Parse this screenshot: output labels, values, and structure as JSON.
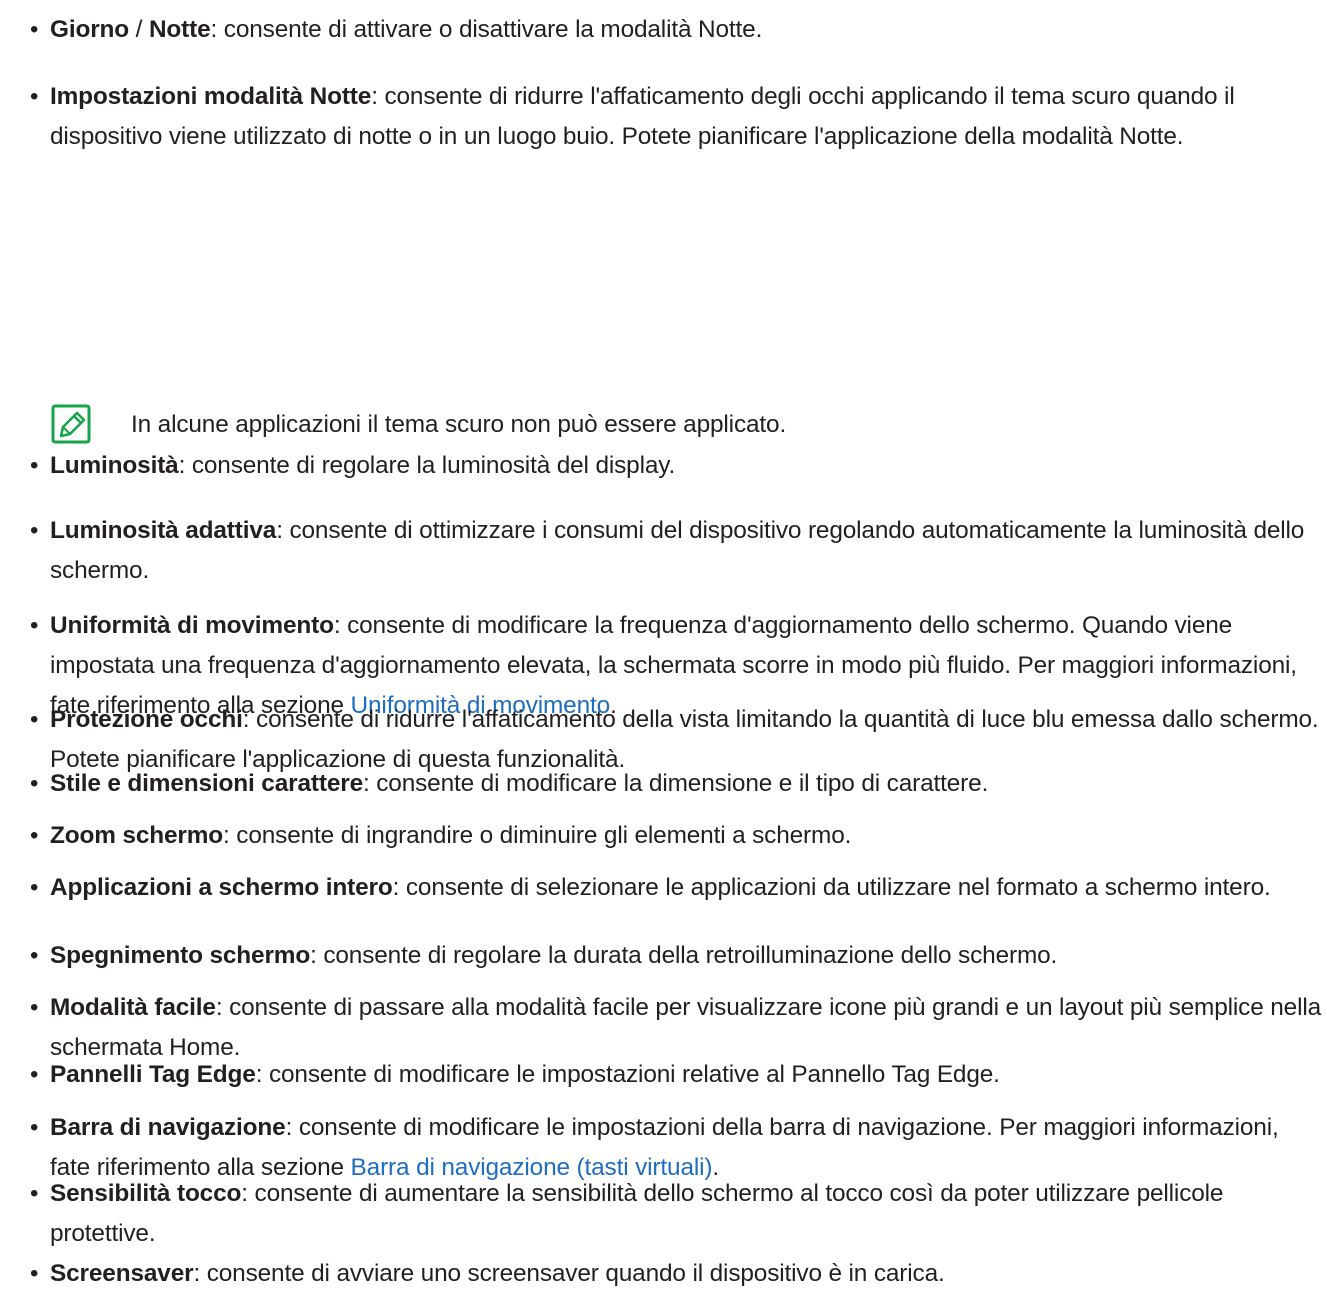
{
  "items": [
    {
      "term": "Giorno",
      "sep": " / ",
      "term2": "Notte",
      "desc": ": consente di attivare o disattivare la modalità Notte."
    },
    {
      "term": "Impostazioni modalità Notte",
      "desc": ": consente di ridurre l'affaticamento degli occhi applicando il tema scuro quando il dispositivo viene utilizzato di notte o in un luogo buio. Potete pianificare l'applicazione della modalità Notte."
    },
    {
      "term": "Luminosità",
      "desc": ": consente di regolare la luminosità del display."
    },
    {
      "term": "Luminosità adattiva",
      "desc": ": consente di ottimizzare i consumi del dispositivo regolando automaticamente la luminosità dello schermo."
    },
    {
      "term": "Uniformità di movimento",
      "desc": ": consente di modificare la frequenza d'aggiornamento dello schermo. Quando viene impostata una frequenza d'aggiornamento elevata, la schermata scorre in modo più fluido. Per maggiori informazioni, fate riferimento alla sezione ",
      "link": "Uniformità di movimento",
      "after": "."
    },
    {
      "term": "Protezione occhi",
      "desc": ": consente di ridurre l'affaticamento della vista limitando la quantità di luce blu emessa dallo schermo. Potete pianificare l'applicazione di questa funzionalità."
    },
    {
      "term": "Stile e dimensioni carattere",
      "desc": ": consente di modificare la dimensione e il tipo di carattere."
    },
    {
      "term": "Zoom schermo",
      "desc": ": consente di ingrandire o diminuire gli elementi a schermo."
    },
    {
      "term": "Applicazioni a schermo intero",
      "desc": ": consente di selezionare le applicazioni da utilizzare nel formato a schermo intero."
    },
    {
      "term": "Spegnimento schermo",
      "desc": ": consente di regolare la durata della retroilluminazione dello schermo."
    },
    {
      "term": "Modalità facile",
      "desc": ": consente di passare alla modalità facile per visualizzare icone più grandi e un layout più semplice nella schermata Home."
    },
    {
      "term": "Pannelli Tag Edge",
      "desc": ": consente di modificare le impostazioni relative al Pannello Tag Edge."
    },
    {
      "term": "Barra di navigazione",
      "desc": ": consente di modificare le impostazioni della barra di navigazione. Per maggiori informazioni, fate riferimento alla sezione ",
      "link": "Barra di navigazione (tasti virtuali)",
      "after": "."
    },
    {
      "term": "Sensibilità tocco",
      "desc": ": consente di aumentare la sensibilità dello schermo al tocco così da poter utilizzare pellicole protettive."
    },
    {
      "term": "Screensaver",
      "desc": ": consente di avviare uno screensaver quando il dispositivo è in carica."
    }
  ],
  "bullet": "•",
  "note": {
    "icon": "note-pencil-icon",
    "text": "In alcune applicazioni il tema scuro non può essere applicato."
  },
  "colors": {
    "text": "#231f20",
    "link": "#1f6dbf",
    "icon": "#16a34a"
  }
}
